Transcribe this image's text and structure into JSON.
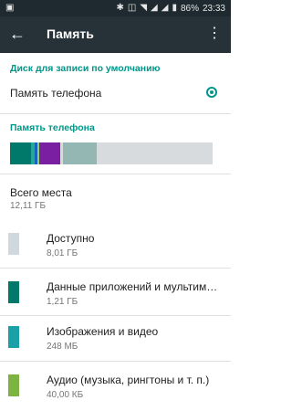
{
  "status_bar": {
    "battery": "86%",
    "time": "23:33"
  },
  "app_bar": {
    "title": "Память"
  },
  "default_disk": {
    "header": "Диск для записи по умолчанию",
    "option_label": "Память телефона",
    "selected": true
  },
  "phone_storage": {
    "header": "Память телефона",
    "usage_segments": [
      {
        "color": "#00796b",
        "fraction": 0.1
      },
      {
        "color": "#26a69a",
        "fraction": 0.015
      },
      {
        "color": "#1565c0",
        "fraction": 0.015
      },
      {
        "color": "#9ccc65",
        "fraction": 0.01
      },
      {
        "color": "#7b1fa2",
        "fraction": 0.1
      },
      {
        "color": "#d7dbdd",
        "fraction": 0.01
      },
      {
        "color": "#95b7b3",
        "fraction": 0.16
      },
      {
        "color": "#d7dbdd",
        "fraction": 0.55
      }
    ],
    "total_title": "Всего места",
    "total_value": "12,11 ГБ"
  },
  "items": [
    {
      "title": "Доступно",
      "value": "8,01 ГБ",
      "color": "#cfd8dc"
    },
    {
      "title": "Данные приложений и мультимед...",
      "value": "1,21 ГБ",
      "color": "#00796b"
    },
    {
      "title": "Изображения и видео",
      "value": "248 МБ",
      "color": "#1ba0a8"
    },
    {
      "title": "Аудио (музыка, рингтоны и т. п.)",
      "value": "40,00 КБ",
      "color": "#7cb342"
    }
  ]
}
